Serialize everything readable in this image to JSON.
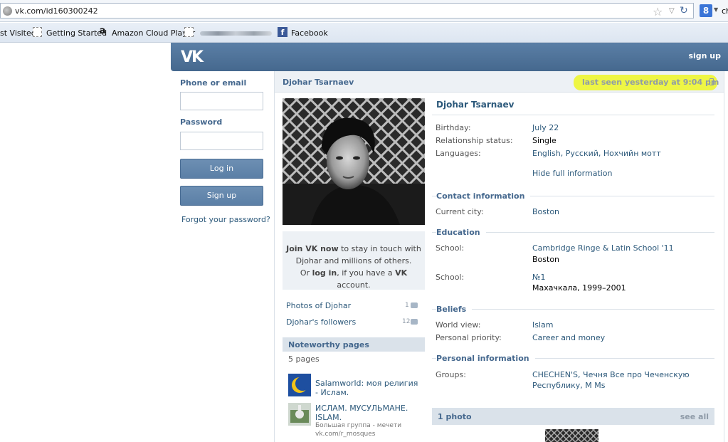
{
  "browser": {
    "url": "vk.com/id160300242",
    "search_engine_letter": "8",
    "search_text": "ch"
  },
  "bookmarks": {
    "items": [
      {
        "label": "st Visited"
      },
      {
        "label": "Getting Started"
      },
      {
        "label": "Amazon Cloud Player"
      },
      {
        "label": "Facebook"
      }
    ]
  },
  "vk": {
    "logo": "VK",
    "signup_top": "sign up"
  },
  "login": {
    "phone_label": "Phone or email",
    "password_label": "Password",
    "login_button": "Log in",
    "signup_button": "Sign up",
    "forgot": "Forgot your password?"
  },
  "profile": {
    "name_bar": "Djohar Tsarnaev",
    "last_seen": "last seen yesterday at 9:04 pm",
    "name": "Djohar Tsarnaev",
    "birthday_label": "Birthday:",
    "birthday": "July 22",
    "relationship_label": "Relationship status:",
    "relationship": "Single",
    "languages_label": "Languages:",
    "languages": "English, Русский, Нохчийн мотт",
    "hide_info": "Hide full information",
    "contact_section": "Contact information",
    "city_label": "Current city:",
    "city": "Boston",
    "education_section": "Education",
    "school_label": "School:",
    "school1_name": "Cambridge Ringe & Latin School '11",
    "school1_city": "Boston",
    "school2_label": "School:",
    "school2_name": "№1",
    "school2_city": "Махачкала, 1999–2001",
    "beliefs_section": "Beliefs",
    "worldview_label": "World view:",
    "worldview": "Islam",
    "priority_label": "Personal priority:",
    "priority": "Career and money",
    "personal_section": "Personal information",
    "groups_label": "Groups:",
    "groups_line1": "CHECHEN'S, Чечня Все про Чеченскую",
    "groups_line2": "Республику, M Ms",
    "photos_bar_title": "1 photo",
    "photos_bar_see": "see all"
  },
  "left_column": {
    "join_line1_bold": "Join VK now",
    "join_line1_rest": " to stay in touch with",
    "join_line2": "Djohar and millions of others.",
    "join_line3_a": "Or ",
    "join_line3_bold": "log in",
    "join_line3_b": ", if you have a ",
    "join_line3_vk": "VK",
    "join_line3_c": " account.",
    "photos_link": "Photos of Djohar",
    "photos_count": "1",
    "followers_link": "Djohar's followers",
    "followers_count": "12",
    "noteworthy_title": "Noteworthy pages",
    "noteworthy_count": "5 pages",
    "page1_name": "Salamworld: моя религия - Ислам.",
    "page2_name": "ИСЛАМ. МУСУЛЬМАНЕ. ISLAM.",
    "page2_sub": "Большая группа - мечети vk.com/r_mosques"
  },
  "colors": {
    "vk_header": "#5b7fa6",
    "vk_link": "#2b587a",
    "vk_section": "#45688e",
    "highlight": "#eef53a"
  }
}
